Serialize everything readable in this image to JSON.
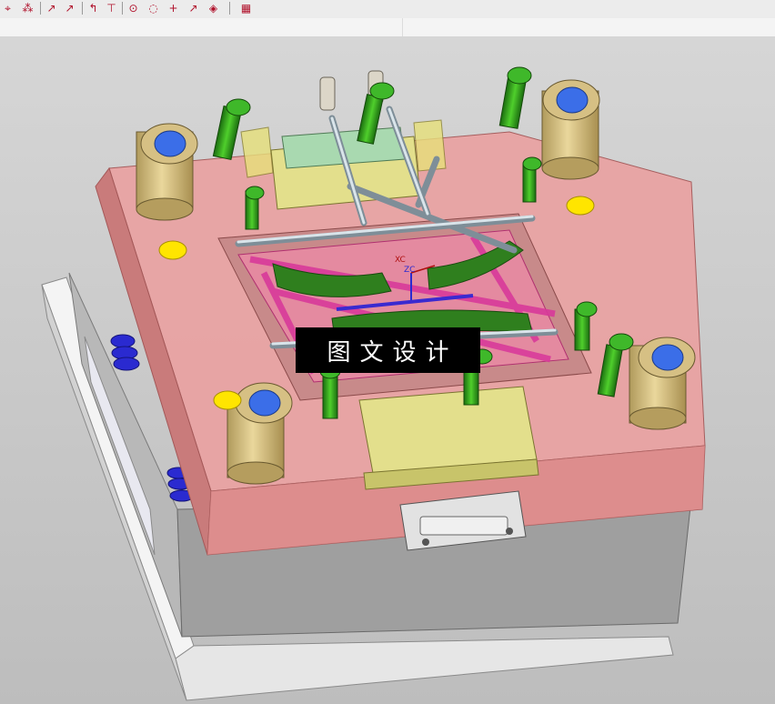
{
  "toolbar": {
    "buttons": [
      {
        "name": "snap-point-tool",
        "icon": "snap-points-icon",
        "glyph": "⌖"
      },
      {
        "name": "snap-filter-tool",
        "icon": "snap-filter-icon",
        "glyph": "⁂"
      },
      {
        "name": "end-point-tool",
        "icon": "end-point-icon",
        "glyph": "↗"
      },
      {
        "name": "mid-point-tool",
        "icon": "mid-point-icon",
        "glyph": "↗"
      },
      {
        "name": "control-point-tool",
        "icon": "control-point-icon",
        "glyph": "↰"
      },
      {
        "name": "intersection-tool",
        "icon": "intersection-icon",
        "glyph": "⊤"
      },
      {
        "name": "arc-center-tool",
        "icon": "arc-center-icon",
        "glyph": "⊙"
      },
      {
        "name": "quadrant-point-tool",
        "icon": "quadrant-point-icon",
        "glyph": "◌"
      },
      {
        "name": "existing-point-tool",
        "icon": "existing-point-icon",
        "glyph": "+"
      },
      {
        "name": "point-on-curve-tool",
        "icon": "point-on-curve-icon",
        "glyph": "↗"
      },
      {
        "name": "point-on-face-tool",
        "icon": "point-on-face-icon",
        "glyph": "◈"
      },
      {
        "name": "grid-tool",
        "icon": "grid-icon",
        "glyph": "▦"
      }
    ]
  },
  "viewport": {
    "triad_labels": {
      "x": "XC",
      "z": "ZC"
    },
    "watermark_text": "图文设计"
  },
  "colors": {
    "background": "#c9c9c9",
    "plate_pink": "#e49a9a",
    "plate_gray": "#9a9a9a",
    "guide_bushing": "#d9c48a",
    "bushing_hole": "#3b6ee8",
    "bolt_green": "#2f9a1c",
    "slider_khaki": "#e3df8c",
    "cooling_line": "#c8d4dc",
    "runner_magenta": "#d83a9a",
    "spring_blue": "#2a2ad0",
    "marker_yellow": "#ffe500"
  }
}
